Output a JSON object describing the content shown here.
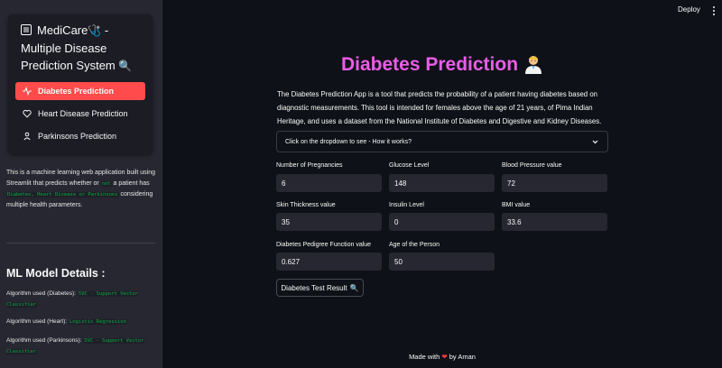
{
  "header": {
    "deploy_label": "Deploy",
    "menu_icon": "kebab-menu-icon"
  },
  "sidebar": {
    "title_line1": "MediCare",
    "title_line2": "Multiple Disease",
    "title_line3": "Prediction System",
    "title_emoji_1": "🩺",
    "title_emoji_2": "🔍",
    "nav_items": [
      {
        "label": "Diabetes Prediction",
        "icon": "activity-icon",
        "active": true
      },
      {
        "label": "Heart Disease Prediction",
        "icon": "heart-icon",
        "active": false
      },
      {
        "label": "Parkinsons Prediction",
        "icon": "person-icon",
        "active": false
      }
    ],
    "description": {
      "part1": "This is a machine learning web application built using Streamlit that predicts whether or ",
      "code_not": "not",
      "part2": " a patient has ",
      "code_diseases": "Diabetes, Heart Disease or Parkinsons",
      "part3": " considering multiple health parameters."
    },
    "ml_title": "ML Model Details :",
    "algorithms": [
      {
        "label": "Algorithm used (Diabetes): ",
        "value": "SVC - Support Vector Classifier"
      },
      {
        "label": "Algorithm used (Heart): ",
        "value": "Logistic Regression"
      },
      {
        "label": "Algorithm used (Parkinsons): ",
        "value": "SVC - Support Vector Classifier"
      }
    ]
  },
  "main": {
    "title": "Diabetes Prediction",
    "title_emoji": "👨‍⚕️",
    "intro": "The Diabetes Prediction App is a tool that predicts the probability of a patient having diabetes based on diagnostic measurements. This tool is intended for females above the age of 21 years, of Pima Indian Heritage, and uses a dataset from the National Institute of Diabetes and Digestive and Kidney Diseases.",
    "expander_label": "Click on the dropdown to see - How it works?",
    "fields": [
      {
        "label": "Number of Pregnancies",
        "value": "6"
      },
      {
        "label": "Glucose Level",
        "value": "148"
      },
      {
        "label": "Blood Pressure value",
        "value": "72"
      },
      {
        "label": "Skin Thickness value",
        "value": "35"
      },
      {
        "label": "Insulin Level",
        "value": "0"
      },
      {
        "label": "BMI value",
        "value": "33.6"
      },
      {
        "label": "Diabetes Pedigree Function value",
        "value": "0.627"
      },
      {
        "label": "Age of the Person",
        "value": "50"
      }
    ],
    "button_label": "Diabetes Test Result",
    "button_emoji": "🔍"
  },
  "footer": {
    "made_with": "Made with",
    "heart": "❤",
    "by": "by Aman"
  },
  "colors": {
    "accent": "#ff4b4b",
    "title": "#ea5de8",
    "code": "#09ab3b",
    "background": "#0e1117",
    "sidebar": "#262730"
  }
}
